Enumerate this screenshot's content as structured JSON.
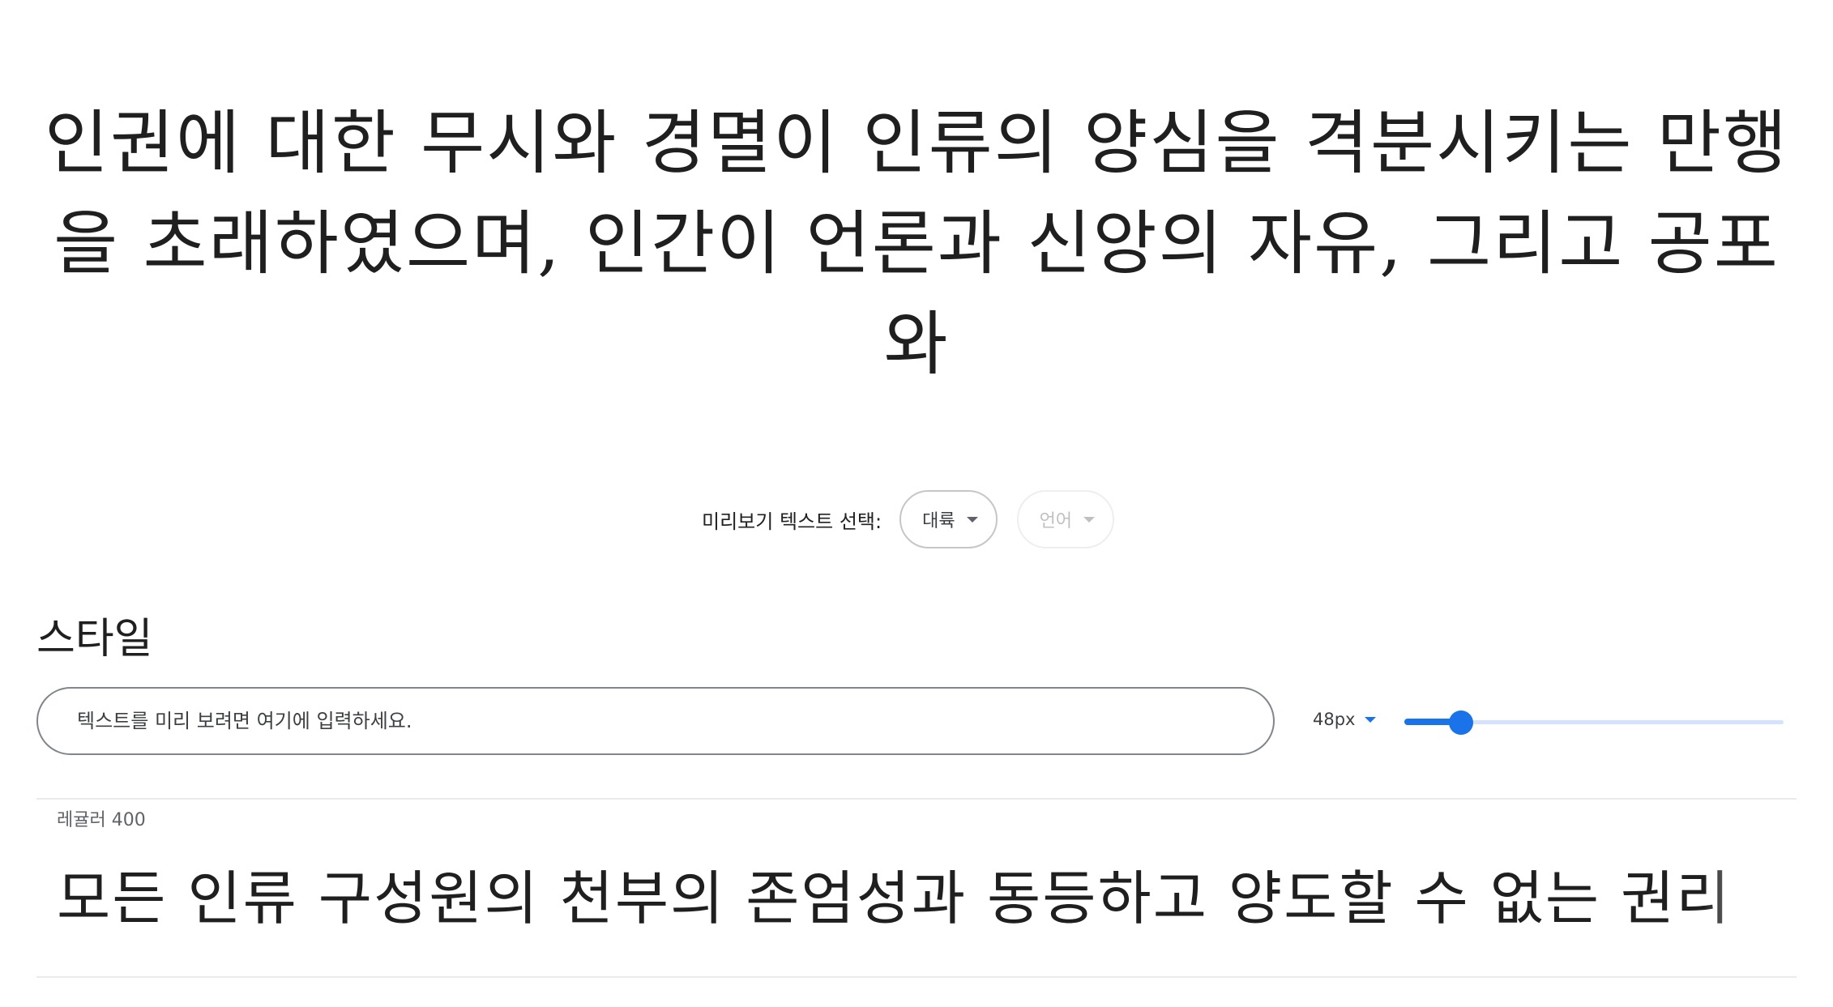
{
  "hero": {
    "text": "인권에 대한 무시와 경멸이 인류의 양심을 격분시키는 만행을 초래하였으며, 인간이 언론과 신앙의 자유, 그리고 공포와"
  },
  "preview_picker": {
    "label": "미리보기 텍스트 선택:",
    "region": {
      "label": "대륙",
      "enabled": true
    },
    "language": {
      "label": "언어",
      "enabled": false
    }
  },
  "styles": {
    "title": "스타일",
    "preview_input": {
      "value": "",
      "placeholder": "텍스트를 미리 보려면 여기에 입력하세요."
    },
    "font_size": {
      "label": "48px",
      "slider_fraction": 0.15
    },
    "items": [
      {
        "name": "레귤러 400",
        "sample": "모든 인류 구성원의 천부의 존엄성과 동등하고 양도할 수 없는 권리"
      }
    ]
  },
  "colors": {
    "accent": "#1a73e8",
    "track": "#d3e3fd",
    "divider": "#e8eaed"
  }
}
